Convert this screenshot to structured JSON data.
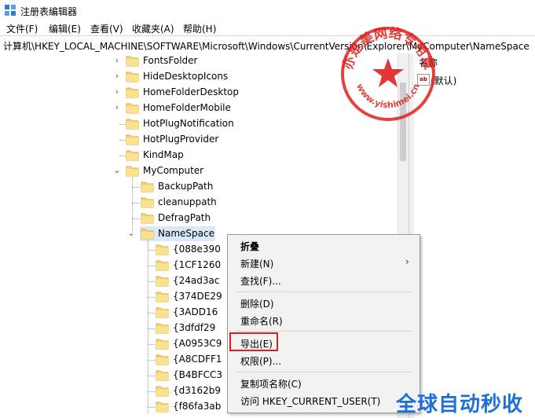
{
  "window": {
    "title": "注册表编辑器"
  },
  "menu": [
    "文件(F)",
    "编辑(E)",
    "查看(V)",
    "收藏夹(A)",
    "帮助(H)"
  ],
  "address": "计算机\\HKEY_LOCAL_MACHINE\\SOFTWARE\\Microsoft\\Windows\\CurrentVersion\\Explorer\\MyComputer\\NameSpace",
  "tree": {
    "level1": [
      {
        "label": "FontsFolder",
        "expandable": true
      },
      {
        "label": "HideDesktopIcons",
        "expandable": true
      },
      {
        "label": "HomeFolderDesktop",
        "expandable": true
      },
      {
        "label": "HomeFolderMobile",
        "expandable": true
      },
      {
        "label": "HotPlugNotification",
        "expandable": false
      },
      {
        "label": "HotPlugProvider",
        "expandable": false
      },
      {
        "label": "KindMap",
        "expandable": false
      },
      {
        "label": "MyComputer",
        "expandable": true,
        "expanded": true
      }
    ],
    "mycomputer_children": [
      {
        "label": "BackupPath"
      },
      {
        "label": "cleanuppath"
      },
      {
        "label": "DefragPath"
      },
      {
        "label": "NameSpace",
        "selected": true
      }
    ],
    "namespace_children": [
      "{088e390",
      "{1CF1260",
      "{24ad3ac",
      "{374DE29",
      "{3ADD16",
      "{3dfdf29",
      "{A0953C9",
      "{A8CDFF1",
      "{B4BFCC3",
      "{d3162b9",
      "{f86fa3ab"
    ]
  },
  "values_pane": {
    "column_header": "名称",
    "rows": [
      {
        "icon": "ab",
        "name": "(默认)"
      }
    ]
  },
  "context_menu": {
    "items": [
      {
        "label": "折叠",
        "bold": true
      },
      {
        "label": "新建(N)",
        "submenu": true
      },
      {
        "label": "查找(F)..."
      },
      {
        "label": "删除(D)"
      },
      {
        "label": "重命名(R)"
      },
      {
        "label": "导出(E)",
        "highlighted": true
      },
      {
        "label": "权限(P)..."
      },
      {
        "label": "复制项名称(C)"
      },
      {
        "label": "访问 HKEY_CURRENT_USER(T)"
      }
    ]
  },
  "watermark": {
    "stamp_text": "亦是美网络专用章",
    "stamp_url": "www.yishimei.cn",
    "bottom_text": "全球自动秒收"
  },
  "colors": {
    "selection": "#d9e8fb",
    "highlight_box": "#e02020",
    "stamp": "#e02020",
    "watermark": "#1f6fd8"
  }
}
